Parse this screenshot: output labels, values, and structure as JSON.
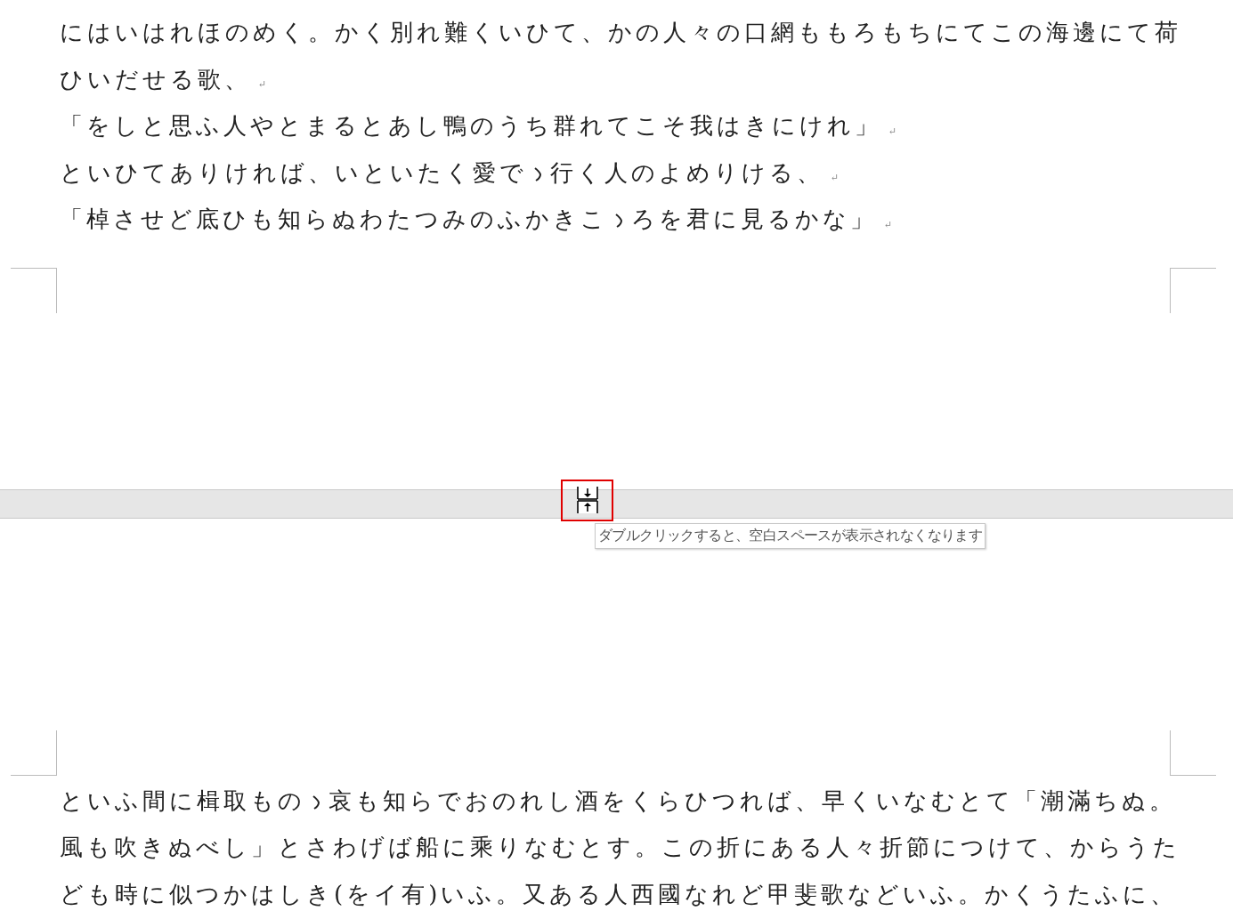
{
  "top_page": {
    "lines": [
      {
        "text": "にはいはれほのめく。かく別れ難くいひて、かの人々の口網ももろもちにてこの海邊にて荷"
      },
      {
        "text": "ひいだせる歌、",
        "paragraph_mark": "↵"
      },
      {
        "text": "「をしと思ふ人やとまるとあし鴨のうち群れてこそ我はきにけれ」",
        "paragraph_mark": "↵"
      },
      {
        "text": "といひてありければ、いといたく愛でゝ行く人のよめりける、",
        "paragraph_mark": "↵"
      },
      {
        "text": "「棹させど底ひも知らぬわたつみのふかきこゝろを君に見るかな」",
        "paragraph_mark": "↵"
      }
    ]
  },
  "page_gap": {
    "tooltip": "ダブルクリックすると、空白スペースが表示されなくなります"
  },
  "bottom_page": {
    "lines": [
      {
        "text": "といふ間に楫取ものゝ哀も知らでおのれし酒をくらひつれば、早くいなむとて「潮滿ちぬ。"
      },
      {
        "text": "風も吹きぬべし」とさわげば船に乘りなむとす。この折にある人々折節につけて、からうた"
      },
      {
        "text": "ども時に似つかはしき(をイ有)いふ。又ある人西國なれど甲斐歌などいふ。かくうたふに、"
      }
    ]
  }
}
